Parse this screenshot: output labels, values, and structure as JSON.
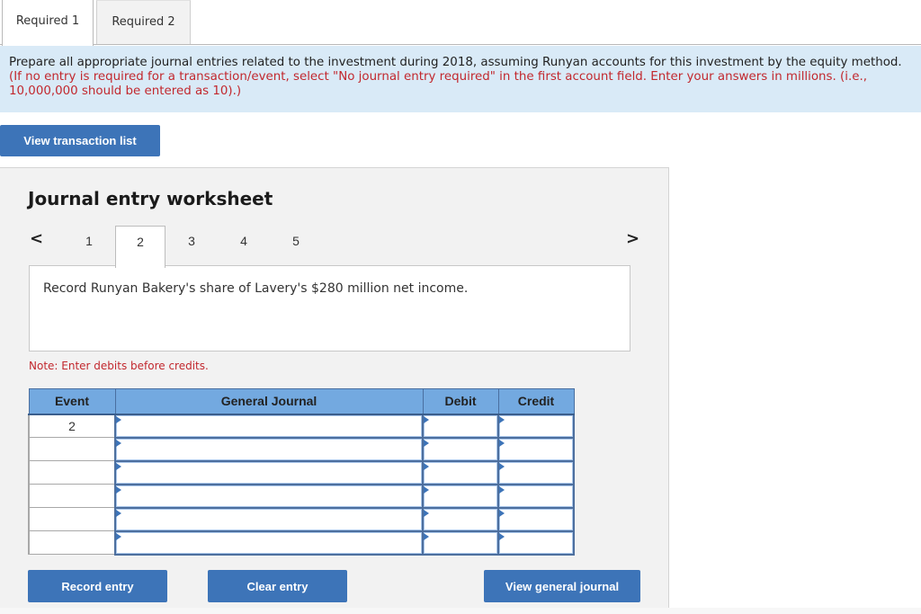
{
  "tabs": [
    {
      "label": "Required 1",
      "active": true
    },
    {
      "label": "Required 2",
      "active": false
    }
  ],
  "instructions": {
    "main": "Prepare all appropriate journal entries related to the investment during 2018, assuming Runyan accounts for this investment by the equity method.",
    "note": "(If no entry is required for a transaction/event, select \"No journal entry required\" in the first account field. Enter your answers in millions. (i.e., 10,000,000 should be entered as 10).)"
  },
  "buttons": {
    "view_transaction_list": "View transaction list",
    "record_entry": "Record entry",
    "clear_entry": "Clear entry",
    "view_general_journal": "View general journal"
  },
  "worksheet": {
    "title": "Journal entry worksheet",
    "prev_icon": "<",
    "next_icon": ">",
    "steps": [
      "1",
      "2",
      "3",
      "4",
      "5"
    ],
    "active_step": "2",
    "description": "Record Runyan Bakery's share of Lavery's $280 million net income.",
    "note": "Note: Enter debits before credits."
  },
  "journal": {
    "headers": {
      "event": "Event",
      "general_journal": "General Journal",
      "debit": "Debit",
      "credit": "Credit"
    },
    "rows": [
      {
        "event": "2",
        "account": "",
        "debit": "",
        "credit": ""
      },
      {
        "event": "",
        "account": "",
        "debit": "",
        "credit": ""
      },
      {
        "event": "",
        "account": "",
        "debit": "",
        "credit": ""
      },
      {
        "event": "",
        "account": "",
        "debit": "",
        "credit": ""
      },
      {
        "event": "",
        "account": "",
        "debit": "",
        "credit": ""
      },
      {
        "event": "",
        "account": "",
        "debit": "",
        "credit": ""
      }
    ]
  },
  "colors": {
    "accent": "#3d74b8",
    "header_blue": "#73a9e0",
    "instruction_bg": "#d9eaf7",
    "warning_red": "#c2282e"
  }
}
